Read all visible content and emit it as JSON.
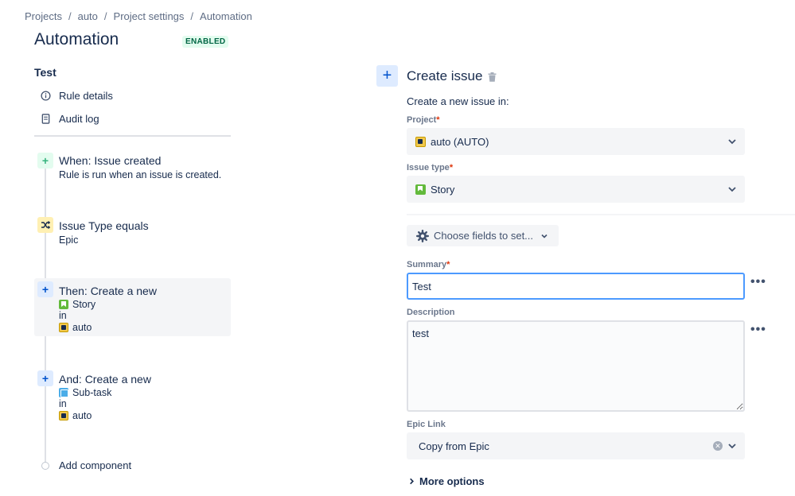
{
  "breadcrumb": [
    "Projects",
    "auto",
    "Project settings",
    "Automation"
  ],
  "page": {
    "title": "Automation",
    "status": "ENABLED"
  },
  "rule": {
    "name": "Test",
    "links": [
      {
        "label": "Rule details",
        "icon": "info-icon"
      },
      {
        "label": "Audit log",
        "icon": "document-icon"
      }
    ]
  },
  "components": {
    "trigger": {
      "title": "When: Issue created",
      "desc": "Rule is run when an issue is created.",
      "icon": "plus-icon"
    },
    "condition": {
      "title": "Issue Type equals",
      "desc": "Epic",
      "icon": "shuffle-icon"
    },
    "action1": {
      "title": "Then: Create a new",
      "issue_type": "Story",
      "in": "in",
      "project": "auto",
      "icon": "plus-icon"
    },
    "action2": {
      "title": "And: Create a new",
      "issue_type": "Sub-task",
      "in": "in",
      "project": "auto",
      "icon": "plus-icon"
    },
    "add_label": "Add component"
  },
  "panel": {
    "title": "Create issue",
    "subtitle": "Create a new issue in:",
    "project_label": "Project",
    "project_value": "auto (AUTO)",
    "issue_type_label": "Issue type",
    "issue_type_value": "Story",
    "choose_fields": "Choose fields to set...",
    "summary_label": "Summary",
    "summary_value": "Test",
    "description_label": "Description",
    "description_value": "test",
    "epic_link_label": "Epic Link",
    "epic_link_value": "Copy from Epic",
    "more_options": "More options",
    "required_mark": "*",
    "more_dots": "•••"
  },
  "colors": {
    "accent": "#0052CC",
    "focus": "#4C9AFF",
    "enabled_bg": "#E3FCEF",
    "enabled_text": "#006644",
    "required": "#DE350B"
  }
}
